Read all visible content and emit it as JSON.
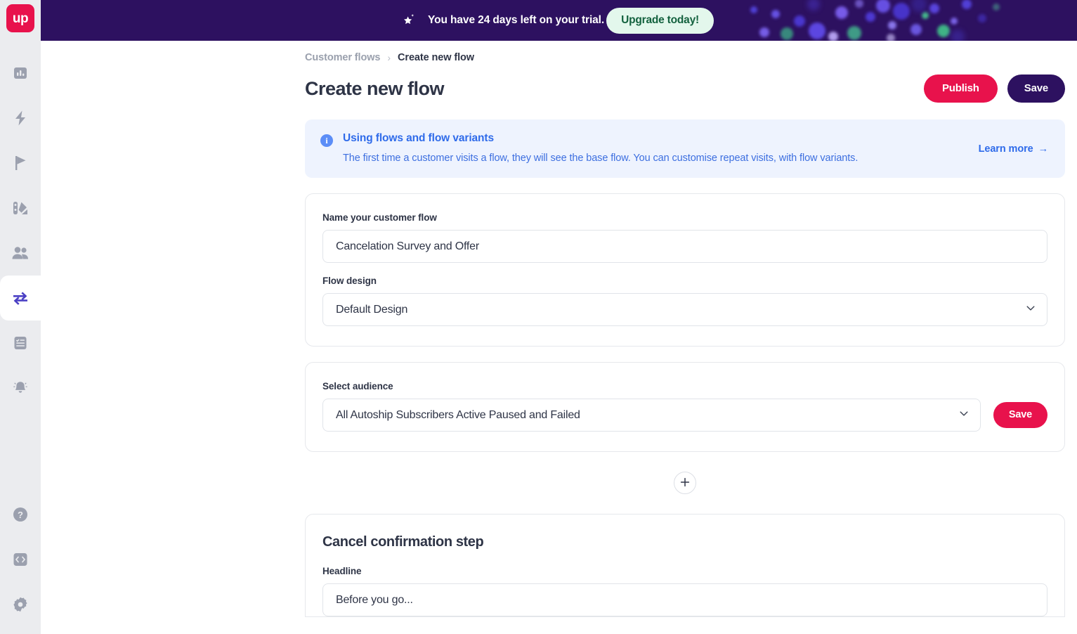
{
  "app": {
    "logo_text": "up",
    "brand_pink": "#e8124c",
    "brand_purple": "#2d1160",
    "accent_blue": "#2f6bea",
    "sidebar_active_color": "#4a3fc4"
  },
  "sidebar": {
    "items": [
      {
        "icon": "analytics-icon",
        "name": "sidebar-item-analytics",
        "active": false
      },
      {
        "icon": "bolt-icon",
        "name": "sidebar-item-automations",
        "active": false
      },
      {
        "icon": "flag-icon",
        "name": "sidebar-item-goals",
        "active": false
      },
      {
        "icon": "palette-icon",
        "name": "sidebar-item-design",
        "active": false
      },
      {
        "icon": "people-icon",
        "name": "sidebar-item-audience",
        "active": false
      },
      {
        "icon": "transfer-arrows-icon",
        "name": "sidebar-item-flows",
        "active": true
      },
      {
        "icon": "checklist-icon",
        "name": "sidebar-item-tasks",
        "active": false
      },
      {
        "icon": "bell-icon",
        "name": "sidebar-item-notifications",
        "active": false
      }
    ],
    "bottom_items": [
      {
        "icon": "help-icon",
        "name": "sidebar-item-help"
      },
      {
        "icon": "code-icon",
        "name": "sidebar-item-developer"
      },
      {
        "icon": "gear-icon",
        "name": "sidebar-item-settings"
      }
    ]
  },
  "banner": {
    "icon": "sparkle-star-icon",
    "message": "You have 24 days left on your trial.",
    "cta_label": "Upgrade today!",
    "background": "#2d1160",
    "cta_background": "#e3f7ec",
    "cta_text_color": "#14623f"
  },
  "breadcrumb": {
    "parent": "Customer flows",
    "separator": "›",
    "current": "Create new flow"
  },
  "header": {
    "title": "Create new flow",
    "publish_label": "Publish",
    "save_label": "Save"
  },
  "info_banner": {
    "icon": "info-circle-icon",
    "title": "Using flows and flow variants",
    "description": "The first time a customer visits a flow, they will see the base flow. You can customise repeat visits, with flow variants.",
    "link_label": "Learn more",
    "link_arrow": "→"
  },
  "flow_card": {
    "name_label": "Name your customer flow",
    "name_value": "Cancelation Survey and Offer",
    "name_placeholder": "Name your customer flow",
    "design_label": "Flow design",
    "design_value": "Default Design",
    "design_options": [
      "Default Design"
    ]
  },
  "audience_card": {
    "label": "Select audience",
    "value": "All Autoship Subscribers Active Paused and Failed",
    "options": [
      "All Autoship Subscribers Active Paused and Failed"
    ],
    "save_label": "Save"
  },
  "add_step": {
    "icon": "plus-icon",
    "label": "+"
  },
  "step_card": {
    "title": "Cancel confirmation step",
    "headline_label": "Headline",
    "headline_value": "Before you go...",
    "headline_placeholder": "Headline"
  }
}
